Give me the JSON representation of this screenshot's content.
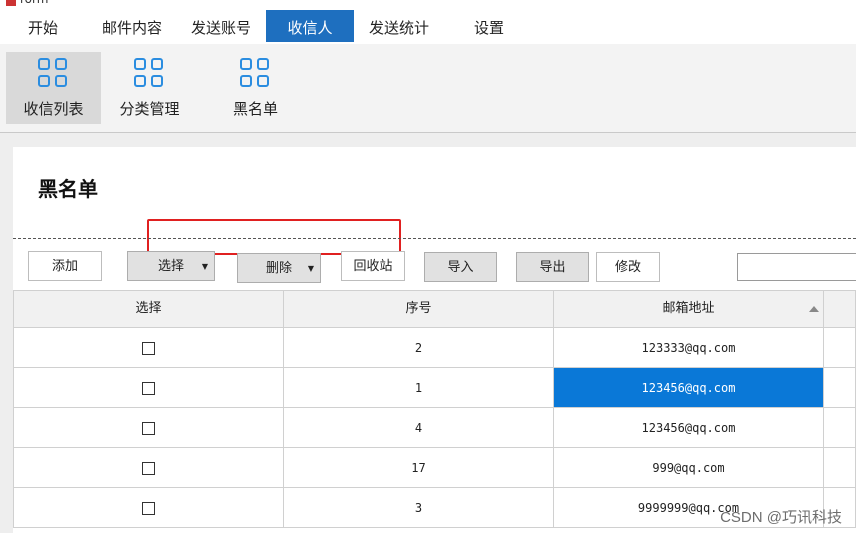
{
  "window": {
    "title": "rorm"
  },
  "menubar": {
    "items": [
      {
        "label": "开始"
      },
      {
        "label": "邮件内容"
      },
      {
        "label": "发送账号"
      },
      {
        "label": "收信人",
        "active": true
      },
      {
        "label": "发送统计"
      },
      {
        "label": "设置"
      }
    ]
  },
  "ribbon": {
    "items": [
      {
        "label": "收信列表",
        "active": true
      },
      {
        "label": "分类管理"
      },
      {
        "label": "黑名单"
      }
    ]
  },
  "page": {
    "title": "黑名单"
  },
  "toolbar": {
    "add": "添加",
    "select": "选择",
    "delete": "删除",
    "recycle": "回收站",
    "import": "导入",
    "export": "导出",
    "edit": "修改",
    "search_value": ""
  },
  "table": {
    "columns": [
      "选择",
      "序号",
      "邮箱地址"
    ],
    "rows": [
      {
        "checked": false,
        "seq": "2",
        "email": "123333@qq.com"
      },
      {
        "checked": false,
        "seq": "1",
        "email": "123456@qq.com",
        "selected": true
      },
      {
        "checked": false,
        "seq": "4",
        "email": "123456@qq.com"
      },
      {
        "checked": false,
        "seq": "17",
        "email": "999@qq.com"
      },
      {
        "checked": false,
        "seq": "3",
        "email": "9999999@qq.com"
      }
    ]
  },
  "watermark": "CSDN @巧讯科技",
  "colors": {
    "accent": "#1e6fbf",
    "selection": "#0a78d7",
    "highlight_box": "#e02020",
    "icon": "#2b8de0"
  }
}
